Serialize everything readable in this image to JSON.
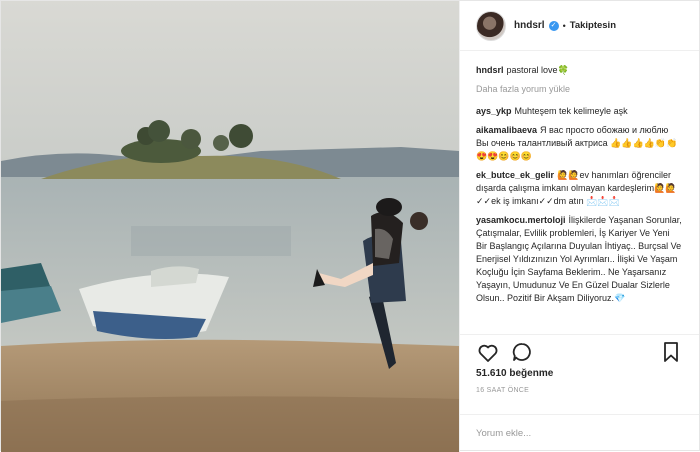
{
  "header": {
    "username": "hndsrl",
    "verified_icon": "verified-badge-icon",
    "separator": "•",
    "follow_status": "Takiptesin"
  },
  "caption": {
    "user": "hndsrl",
    "text": "pastoral love🍀"
  },
  "load_more": "Daha fazla yorum yükle",
  "comments": [
    {
      "user": "ays_ykp",
      "text": "Muhteşem tek kelimeyle aşk"
    },
    {
      "user": "aikamalibaeva",
      "text": "Я вас просто обожаю и люблю Вы очень талантливый актриса 👍👍👍👍👏👏😍😍😊😊😊"
    },
    {
      "user": "ek_butce_ek_gelir",
      "text": "🙋🙋ev hanımları öğrenciler dışarda çalışma imkanı olmayan kardeşlerim🙋🙋✓✓ek iş imkanı✓✓dm atın 📩📩📩"
    },
    {
      "user": "yasamkocu.mertoloji",
      "text": "İlişkilerde Yaşanan Sorunlar, Çatışmalar, Evlilik problemleri, İş Kariyer Ve Yeni Bir Başlangıç Açılarına Duyulan İhtiyaç.. Burçsal Ve Enerjisel Yıldızınızın Yol Ayrımları.. İlişki Ve Yaşam Koçluğu İçin Sayfama Beklerim.. Ne Yaşarsanız Yaşayın, Umudunuz Ve En Güzel Dualar Sizlerle Olsun.. Pozitif Bir Akşam Diliyoruz.💎"
    }
  ],
  "actions": {
    "like_icon": "heart-icon",
    "comment_icon": "comment-icon",
    "save_icon": "bookmark-icon"
  },
  "likes": "51.610 beğenme",
  "time_ago": "16 SAAT ÖNCE",
  "add_comment_placeholder": "Yorum ekle...",
  "colors": {
    "link": "#262626",
    "muted": "#999999",
    "verified": "#3897f0",
    "border": "#efefef"
  }
}
